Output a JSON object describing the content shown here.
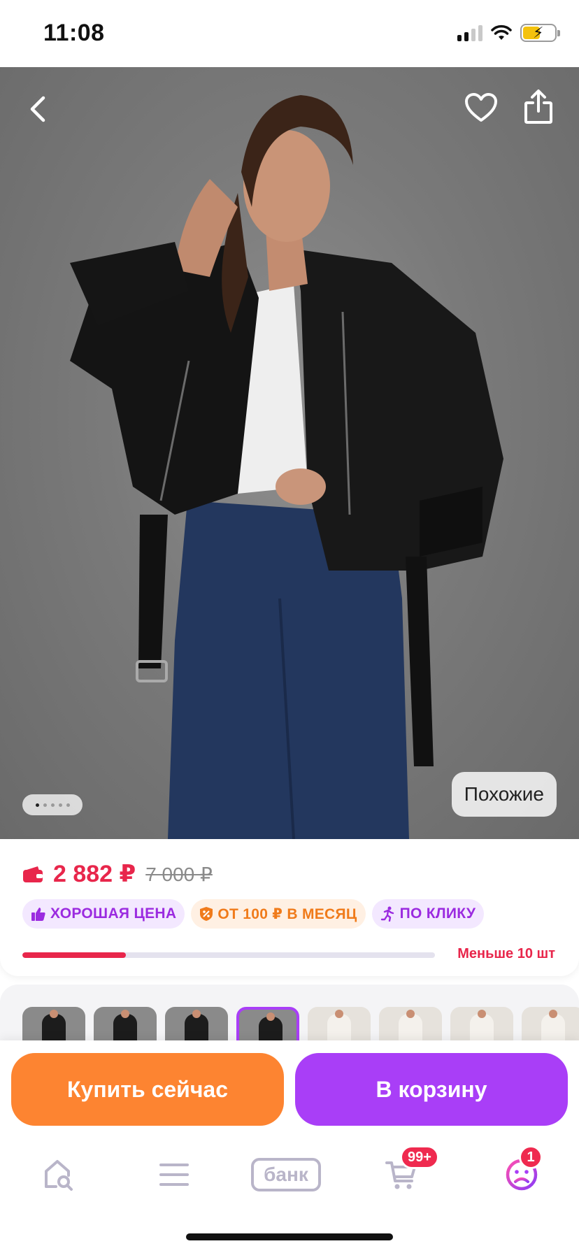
{
  "status_bar": {
    "time": "11:08",
    "signal_icon": "cellular-signal-icon",
    "wifi_icon": "wifi-icon",
    "battery_icon": "battery-charging-icon"
  },
  "product_image": {
    "back_icon": "chevron-left-icon",
    "favorite_icon": "heart-outline-icon",
    "share_icon": "share-icon",
    "page_count": 5,
    "active_page": 1,
    "similar_label": "Похожие"
  },
  "price": {
    "wallet_icon": "wallet-icon",
    "current": "2 882 ₽",
    "old": "7 000 ₽",
    "accent_color": "#e8264b"
  },
  "badges": [
    {
      "icon": "thumbs-up-icon",
      "label": "ХОРОШАЯ ЦЕНА",
      "style": "purple"
    },
    {
      "icon": "percent-shield-icon",
      "label": "ОТ 100 ₽ В МЕСЯЦ",
      "style": "orange"
    },
    {
      "icon": "running-person-icon",
      "label": "ПО КЛИКУ",
      "style": "purple"
    }
  ],
  "stock": {
    "label": "Меньше 10 шт",
    "level": 0.25
  },
  "thumbnails": {
    "count": 8,
    "selected_index": 3
  },
  "actions": {
    "buy_now": "Купить сейчас",
    "add_to_cart": "В корзину",
    "buy_color": "#fd8431",
    "cart_color": "#a93ef7"
  },
  "tab_bar": {
    "home_icon": "home-search-icon",
    "catalog_icon": "menu-icon",
    "bank_label": "банк",
    "cart_icon": "cart-icon",
    "cart_count": "99+",
    "profile_icon": "profile-sad-face-icon",
    "profile_count": "1"
  }
}
